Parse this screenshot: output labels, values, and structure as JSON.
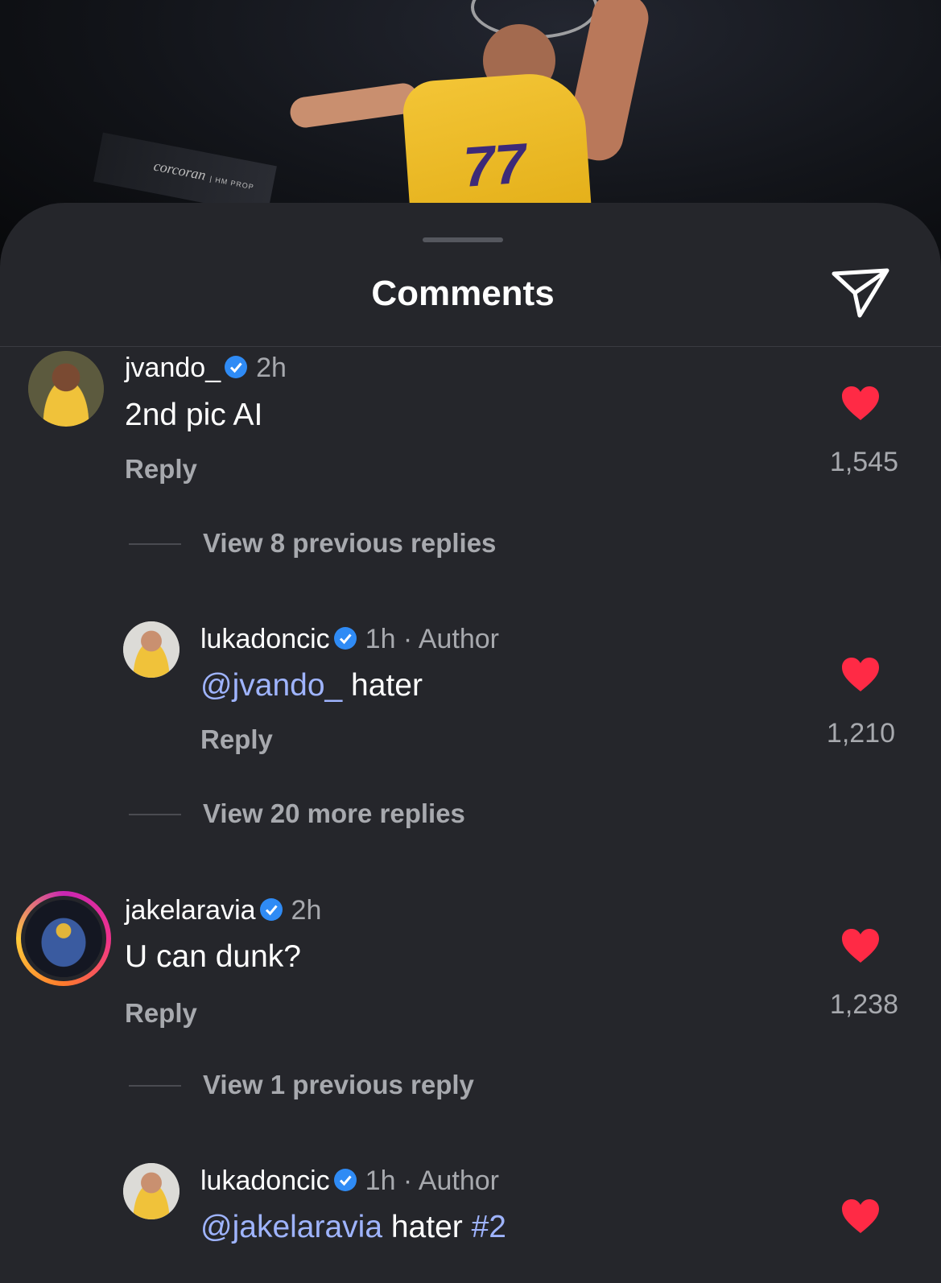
{
  "header": {
    "title": "Comments",
    "share_icon": "send-icon"
  },
  "background": {
    "sign_text": "corcoran",
    "sign_sub": "| HM PROP",
    "jersey_number": "77"
  },
  "colors": {
    "sheet": "#25262b",
    "heart": "#ff2a45",
    "mention": "#9fb4ff",
    "verified": "#2f8bf5"
  },
  "comments": [
    {
      "username": "jvando_",
      "time": "2h",
      "text": "2nd pic AI",
      "reply_label": "Reply",
      "likes": "1,545",
      "view_replies": "View 8 previous replies"
    },
    {
      "username": "lukadoncic",
      "time": "1h · Author",
      "mention": "@jvando_",
      "text": " hater",
      "reply_label": "Reply",
      "likes": "1,210",
      "view_replies": "View 20 more replies"
    },
    {
      "username": "jakelaravia",
      "time": "2h",
      "text": "U can dunk?",
      "reply_label": "Reply",
      "likes": "1,238",
      "view_replies": "View 1 previous reply"
    },
    {
      "username": "lukadoncic",
      "time": "1h · Author",
      "mention": "@jakelaravia",
      "text": " hater ",
      "hashtag": "#2"
    }
  ]
}
